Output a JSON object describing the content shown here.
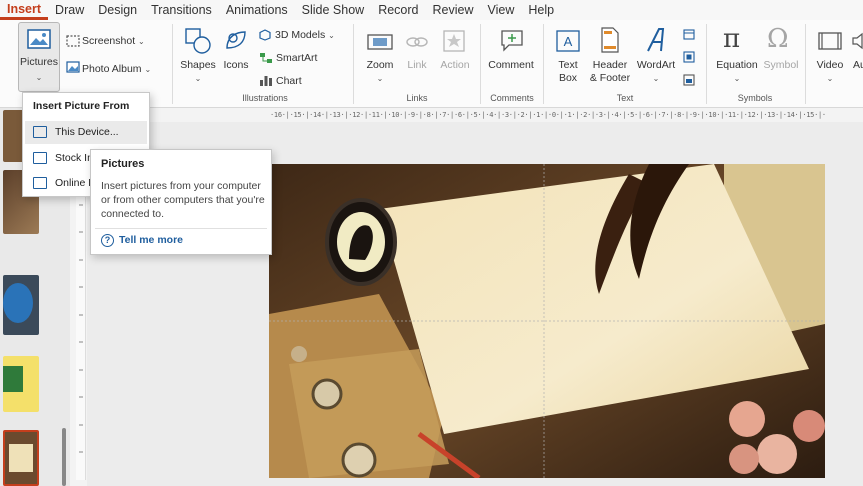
{
  "tabs": [
    "Insert",
    "Draw",
    "Design",
    "Transitions",
    "Animations",
    "Slide Show",
    "Record",
    "Review",
    "View",
    "Help"
  ],
  "active_tab": "Insert",
  "ribbon": {
    "pictures": "Pictures",
    "screenshot": "Screenshot",
    "photo_album": "Photo Album",
    "shapes": "Shapes",
    "icons": "Icons",
    "models_3d": "3D Models",
    "smartart": "SmartArt",
    "chart": "Chart",
    "illustrations_group": "Illustrations",
    "zoom": "Zoom",
    "link": "Link",
    "action": "Action",
    "links_group": "Links",
    "comment": "Comment",
    "comments_group": "Comments",
    "text_box_line1": "Text",
    "text_box_line2": "Box",
    "header_footer_line1": "Header",
    "header_footer_line2": "& Footer",
    "wordart": "WordArt",
    "text_group": "Text",
    "equation": "Equation",
    "symbol": "Symbol",
    "symbols_group": "Symbols",
    "video": "Video",
    "audio": "Au"
  },
  "dropdown": {
    "title": "Insert Picture From",
    "items": [
      "This Device...",
      "Stock Im",
      "Online P"
    ]
  },
  "tooltip": {
    "title": "Pictures",
    "body": "Insert pictures from your computer or from other computers that you're connected to.",
    "help": "Tell me more"
  },
  "ruler": {
    "horizontal": "·16·|·15·|·14·|·13·|·12·|·11·|·10·|·9·|·8·|·7·|·6·|·5·|·4·|·3·|·2·|·1·|·0·|·1·|·2·|·3·|·4·|·5·|·6·|·7·|·8·|·9·|·10·|·11·|·12·|·13·|·14·|·15·|·16·"
  },
  "colors": {
    "accent": "#c43e1c",
    "link": "#1f5e9e"
  }
}
